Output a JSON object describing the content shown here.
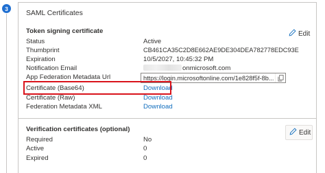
{
  "step": {
    "number": "3"
  },
  "saml": {
    "title": "SAML Certificates",
    "token_section": {
      "title": "Token signing certificate",
      "edit_label": "Edit",
      "rows": [
        {
          "label": "Status",
          "value": "Active"
        },
        {
          "label": "Thumbprint",
          "value": "CB461CA35C2D8E662AE9DE304DEA782778EDC93E"
        },
        {
          "label": "Expiration",
          "value": "10/5/2027, 10:45:32 PM"
        },
        {
          "label": "Notification Email",
          "value": "onmicrosoft.com"
        },
        {
          "label": "App Federation Metadata Url",
          "value": "https://login.microsoftonline.com/1e828f5f-8b..."
        },
        {
          "label": "Certificate (Base64)",
          "value": "Download"
        },
        {
          "label": "Certificate (Raw)",
          "value": "Download"
        },
        {
          "label": "Federation Metadata XML",
          "value": "Download"
        }
      ]
    },
    "verification_section": {
      "title": "Verification certificates (optional)",
      "edit_label": "Edit",
      "rows": [
        {
          "label": "Required",
          "value": "No"
        },
        {
          "label": "Active",
          "value": "0"
        },
        {
          "label": "Expired",
          "value": "0"
        }
      ]
    }
  },
  "colors": {
    "link": "#0f6cbd",
    "highlight": "#d9121a",
    "badge": "#1f6fd1"
  },
  "icons": {
    "edit": "pencil-icon",
    "copy": "copy-icon"
  }
}
